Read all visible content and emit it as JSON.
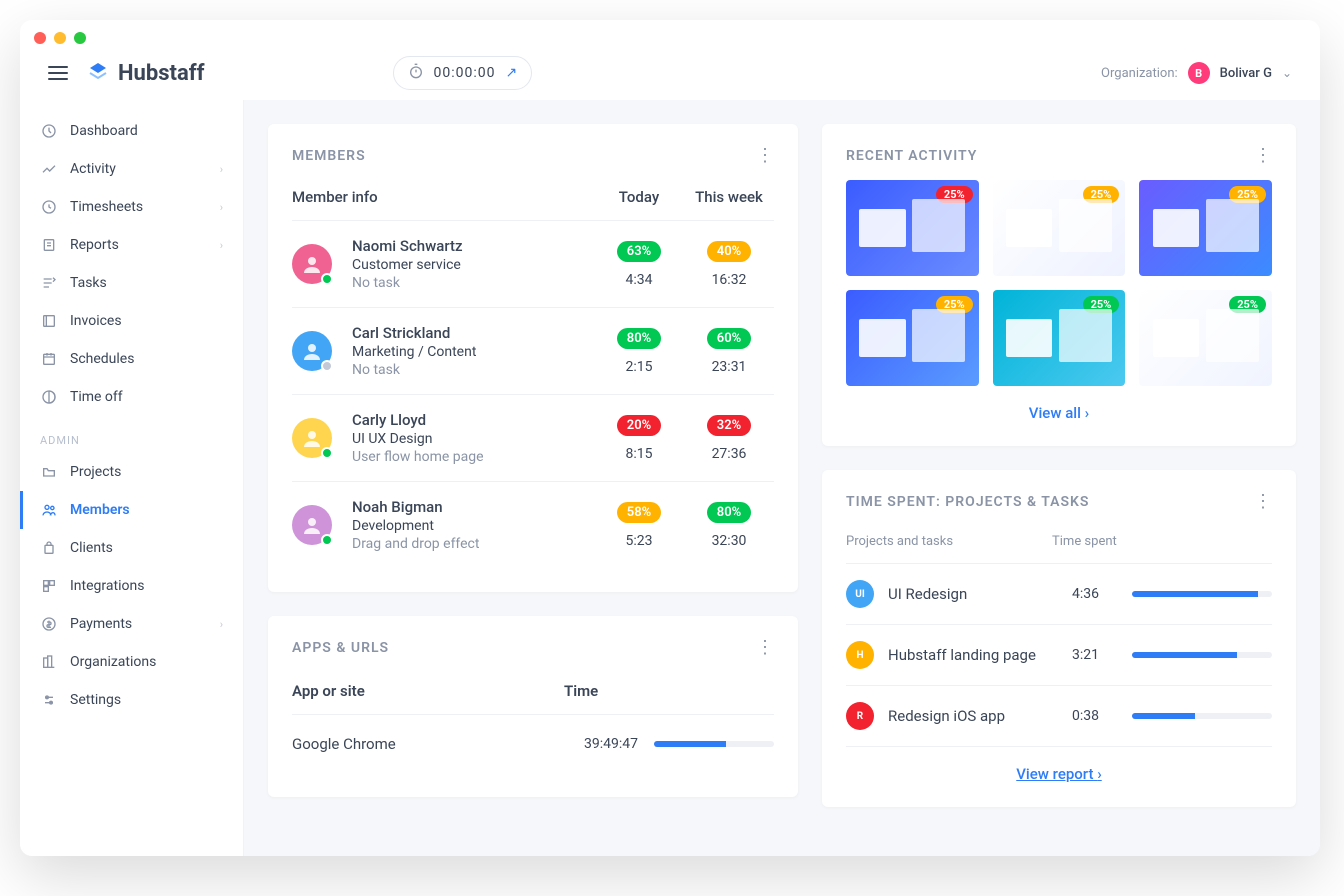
{
  "brand": "Hubstaff",
  "timer": {
    "value": "00:00:00"
  },
  "org": {
    "label": "Organization:",
    "initial": "B",
    "name": "Bolivar G"
  },
  "nav": {
    "items": [
      {
        "label": "Dashboard"
      },
      {
        "label": "Activity",
        "expand": true
      },
      {
        "label": "Timesheets",
        "expand": true
      },
      {
        "label": "Reports",
        "expand": true
      },
      {
        "label": "Tasks"
      },
      {
        "label": "Invoices"
      },
      {
        "label": "Schedules"
      },
      {
        "label": "Time off"
      }
    ],
    "admin_label": "ADMIN",
    "admin": [
      {
        "label": "Projects"
      },
      {
        "label": "Members",
        "active": true
      },
      {
        "label": "Clients"
      },
      {
        "label": "Integrations"
      },
      {
        "label": "Payments",
        "expand": true
      },
      {
        "label": "Organizations"
      },
      {
        "label": "Settings"
      }
    ]
  },
  "members": {
    "title": "MEMBERS",
    "cols": {
      "info": "Member info",
      "today": "Today",
      "week": "This week"
    },
    "rows": [
      {
        "name": "Naomi Schwartz",
        "role": "Customer service",
        "task": "No task",
        "today_pct": "63%",
        "today_color": "green",
        "today_time": "4:34",
        "week_pct": "40%",
        "week_color": "amber",
        "week_time": "16:32",
        "status": "online",
        "avatar_bg": "#f06292"
      },
      {
        "name": "Carl Strickland",
        "role": "Marketing / Content",
        "task": "No task",
        "today_pct": "80%",
        "today_color": "green",
        "today_time": "2:15",
        "week_pct": "60%",
        "week_color": "green",
        "week_time": "23:31",
        "status": "offline",
        "avatar_bg": "#42a5f5"
      },
      {
        "name": "Carly Lloyd",
        "role": "UI UX Design",
        "task": "User flow home page",
        "today_pct": "20%",
        "today_color": "red",
        "today_time": "8:15",
        "week_pct": "32%",
        "week_color": "red",
        "week_time": "27:36",
        "status": "online",
        "avatar_bg": "#ffd54f"
      },
      {
        "name": "Noah Bigman",
        "role": "Development",
        "task": "Drag and drop effect",
        "today_pct": "58%",
        "today_color": "amber",
        "today_time": "5:23",
        "week_pct": "80%",
        "week_color": "green",
        "week_time": "32:30",
        "status": "online",
        "avatar_bg": "#ce93d8"
      }
    ]
  },
  "apps": {
    "title": "APPS & URLS",
    "cols": {
      "name": "App or site",
      "time": "Time"
    },
    "rows": [
      {
        "name": "Google Chrome",
        "time": "39:49:47",
        "pct": 60
      }
    ]
  },
  "recent": {
    "title": "RECENT ACTIVITY",
    "thumbs": [
      {
        "badge": "25%",
        "badge_color": "#f2222e"
      },
      {
        "badge": "25%",
        "badge_color": "#ffb300"
      },
      {
        "badge": "25%",
        "badge_color": "#ffb300"
      },
      {
        "badge": "25%",
        "badge_color": "#ffb300"
      },
      {
        "badge": "25%",
        "badge_color": "#00c853"
      },
      {
        "badge": "25%",
        "badge_color": "#00c853"
      }
    ],
    "view_all": "View all"
  },
  "timespent": {
    "title": "TIME SPENT: PROJECTS & TASKS",
    "cols": {
      "name": "Projects and tasks",
      "time": "Time spent"
    },
    "rows": [
      {
        "initial": "UI",
        "bg": "#42a5f5",
        "name": "UI Redesign",
        "time": "4:36",
        "pct": 90
      },
      {
        "initial": "H",
        "bg": "#ffb300",
        "name": "Hubstaff landing page",
        "time": "3:21",
        "pct": 75
      },
      {
        "initial": "R",
        "bg": "#f2222e",
        "name": "Redesign iOS app",
        "time": "0:38",
        "pct": 45
      }
    ],
    "view_report": "View report"
  }
}
